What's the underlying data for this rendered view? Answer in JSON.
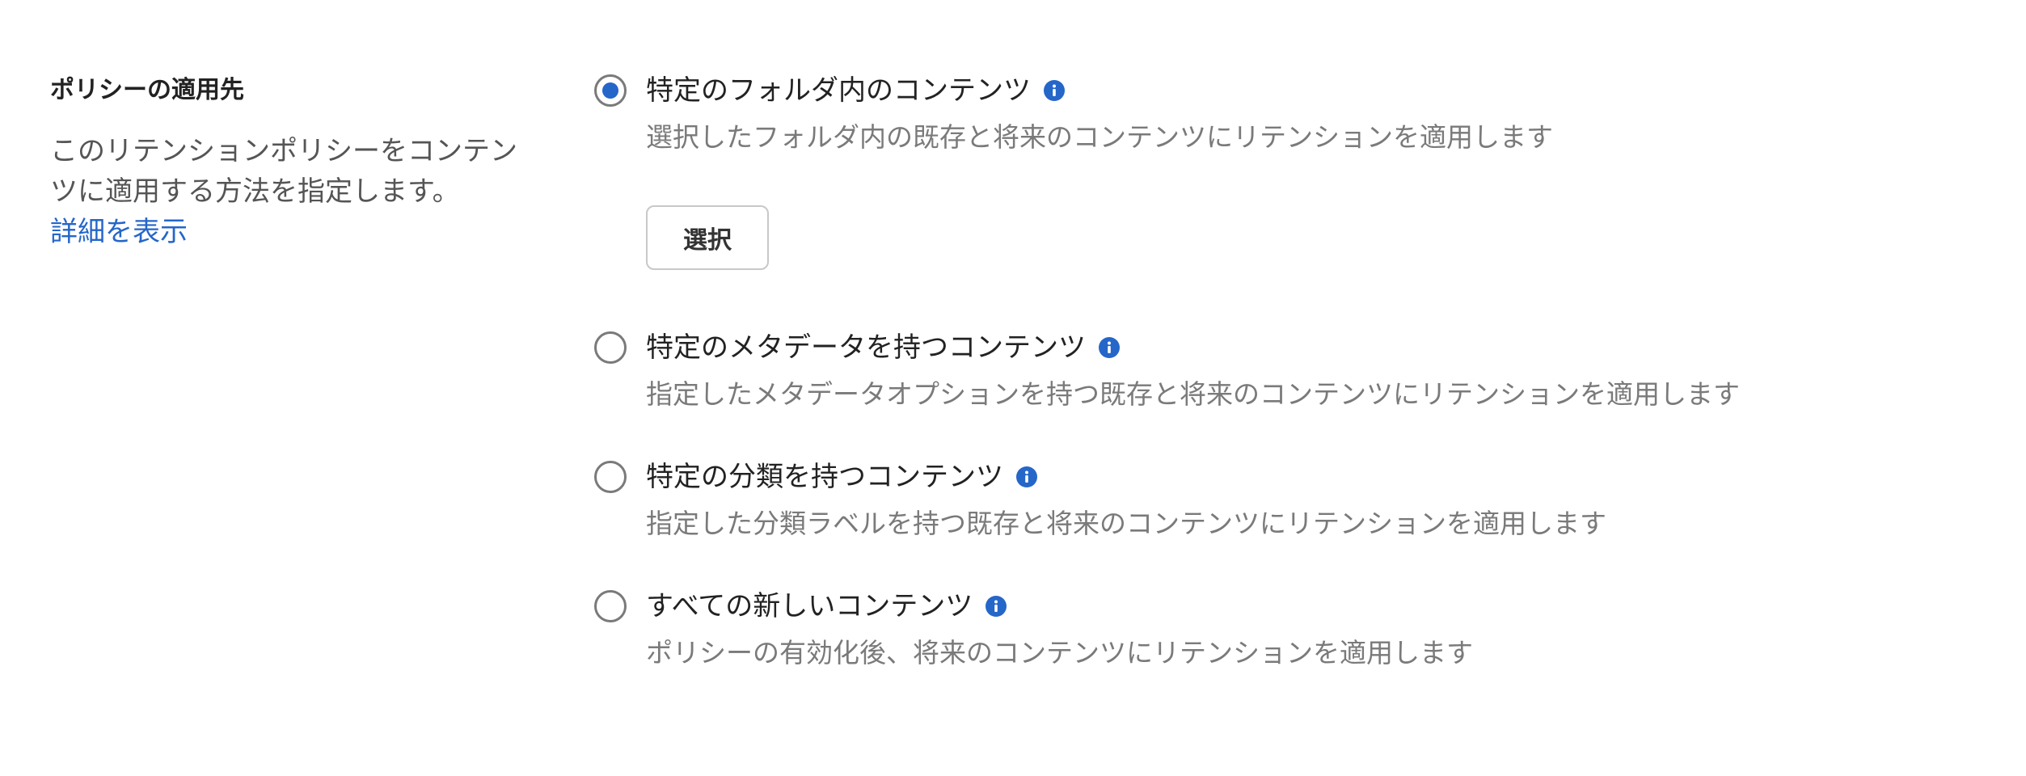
{
  "section": {
    "title": "ポリシーの適用先",
    "description": "このリテンションポリシーをコンテンツに適用する方法を指定します。",
    "learn_more": "詳細を表示"
  },
  "options": [
    {
      "label": "特定のフォルダ内のコンテンツ",
      "description": "選択したフォルダ内の既存と将来のコンテンツにリテンションを適用します",
      "selected": true,
      "icon": "info-icon"
    },
    {
      "label": "特定のメタデータを持つコンテンツ",
      "description": "指定したメタデータオプションを持つ既存と将来のコンテンツにリテンションを適用します",
      "selected": false,
      "icon": "info-icon"
    },
    {
      "label": "特定の分類を持つコンテンツ",
      "description": "指定した分類ラベルを持つ既存と将来のコンテンツにリテンションを適用します",
      "selected": false,
      "icon": "info-icon"
    },
    {
      "label": "すべての新しいコンテンツ",
      "description": "ポリシーの有効化後、将来のコンテンツにリテンションを適用します",
      "selected": false,
      "icon": "info-icon"
    }
  ],
  "select_button": {
    "label": "選択"
  },
  "colors": {
    "accent": "#2566c9",
    "text_primary": "#222222",
    "text_secondary": "#7a7a7a",
    "radio_border": "#7a7a7a",
    "button_border": "#c8c8c8"
  }
}
